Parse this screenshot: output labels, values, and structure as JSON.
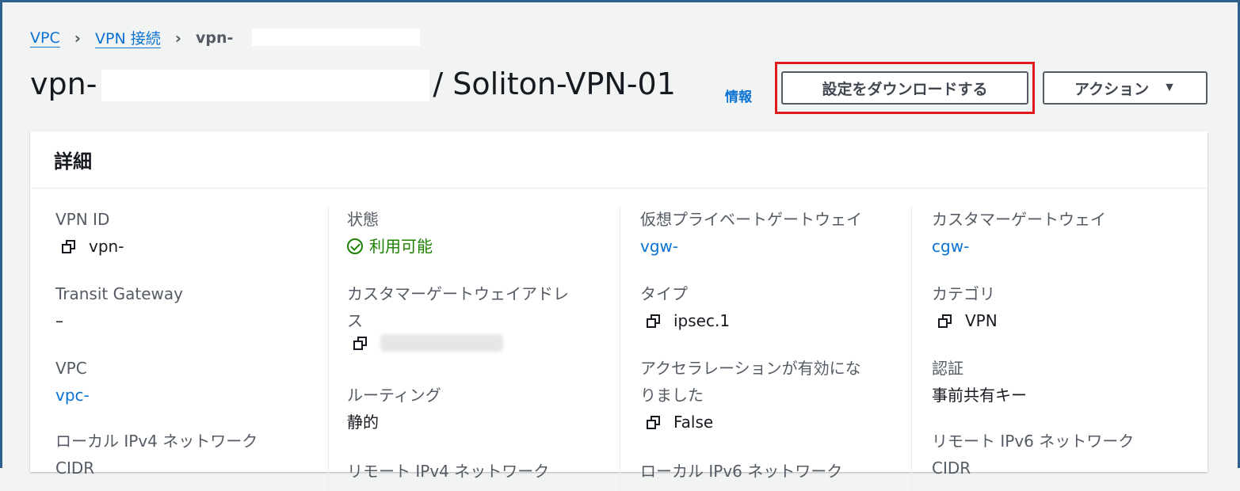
{
  "breadcrumb": {
    "items": [
      "VPC",
      "VPN 接続"
    ],
    "current": "vpn-"
  },
  "header": {
    "title_prefix": "vpn-",
    "title_suffix": "/ Soliton-VPN-01",
    "info_label": "情報",
    "download_button": "設定をダウンロードする",
    "actions_button": "アクション"
  },
  "panel": {
    "title": "詳細",
    "col1": {
      "vpn_id_label": "VPN ID",
      "vpn_id_value": "vpn-",
      "tgw_label": "Transit Gateway",
      "tgw_value": "–",
      "vpc_label": "VPC",
      "vpc_value": "vpc-",
      "local_ipv4_label": "ローカル IPv4 ネットワーク",
      "local_ipv4_label_cont": "CIDR"
    },
    "col2": {
      "state_label": "状態",
      "state_value": "利用可能",
      "cgw_addr_label": "カスタマーゲートウェイアドレ",
      "cgw_addr_label_cont": "ス",
      "routing_label": "ルーティング",
      "routing_value": "静的",
      "remote_ipv4_label": "リモート IPv4 ネットワーク"
    },
    "col3": {
      "vgw_label": "仮想プライベートゲートウェイ",
      "vgw_value": "vgw-",
      "type_label": "タイプ",
      "type_value": "ipsec.1",
      "accel_label": "アクセラレーションが有効にな",
      "accel_label_cont": "りました",
      "accel_value": "False",
      "local_ipv6_label": "ローカル IPv6 ネットワーク"
    },
    "col4": {
      "cgw_label": "カスタマーゲートウェイ",
      "cgw_value": "cgw-",
      "category_label": "カテゴリ",
      "category_value": "VPN",
      "auth_label": "認証",
      "auth_value": "事前共有キー",
      "remote_ipv6_label": "リモート IPv6 ネットワーク",
      "remote_ipv6_label_cont": "CIDR"
    }
  },
  "colors": {
    "link": "#0972d3",
    "success": "#1d8102",
    "highlight": "#e0191f"
  }
}
